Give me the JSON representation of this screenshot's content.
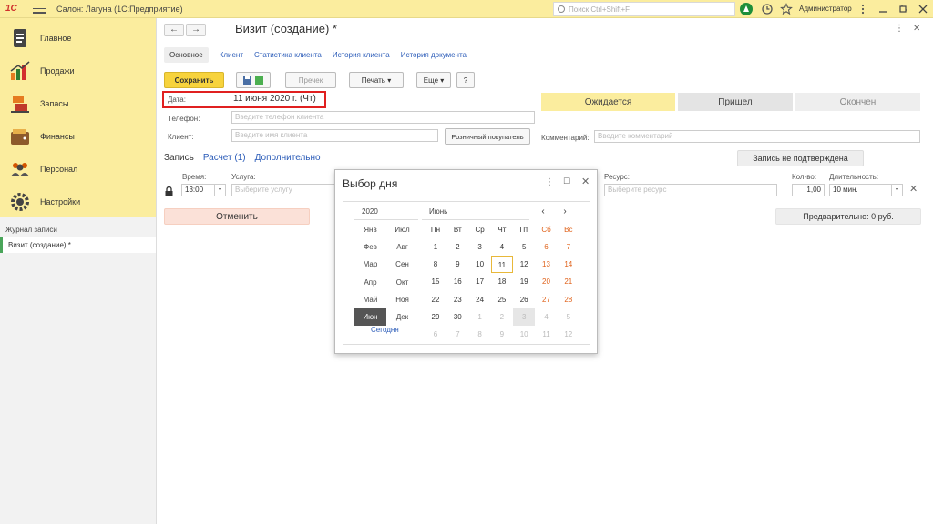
{
  "app": {
    "title": "Салон: Лагуна  (1С:Предприятие)",
    "logo": "1С",
    "search_placeholder": "Поиск Ctrl+Shift+F",
    "user": "Администратор"
  },
  "sidebar": {
    "sections": [
      {
        "label": "Главное",
        "icon": "main-doc-icon"
      },
      {
        "label": "Продажи",
        "icon": "sales-chart-icon"
      },
      {
        "label": "Запасы",
        "icon": "stock-icon"
      },
      {
        "label": "Финансы",
        "icon": "wallet-icon"
      },
      {
        "label": "Персонал",
        "icon": "people-icon"
      },
      {
        "label": "Настройки",
        "icon": "gear-icon"
      }
    ],
    "journal": "Журнал записи",
    "open_item": "Визит (создание) *"
  },
  "form": {
    "title": "Визит (создание) *",
    "tabs": [
      "Основное",
      "Клиент",
      "Статистика клиента",
      "История клиента",
      "История документа"
    ],
    "toolbar": {
      "save": "Сохранить",
      "prechek": "Пречек",
      "print": "Печать",
      "more": "Еще",
      "help": "?"
    },
    "date_label": "Дата:",
    "date_value": "11 июня 2020 г. (Чт)",
    "phone_label": "Телефон:",
    "phone_placeholder": "Введите телефон клиента",
    "client_label": "Клиент:",
    "client_placeholder": "Введите имя клиента",
    "retail_button": "Розничный покупатель",
    "statuses": [
      "Ожидается",
      "Пришел",
      "Окончен"
    ],
    "comment_label": "Комментарий:",
    "comment_placeholder": "Введите комментарий",
    "subtabs": [
      "Запись",
      "Расчет (1)",
      "Дополнительно"
    ],
    "not_confirmed": "Запись не подтверждена",
    "time_label": "Время:",
    "time_value": "13:00",
    "service_label": "Услуга:",
    "service_placeholder": "Выберите услугу",
    "resource_label": "Ресурс:",
    "resource_placeholder": "Выберите ресурс",
    "qty_label": "Кол-во:",
    "qty_value": "1,00",
    "duration_label": "Длительность:",
    "duration_value": "10 мин.",
    "cancel_button": "Отменить",
    "prelim": "Предварительно: 0 руб."
  },
  "picker": {
    "title": "Выбор дня",
    "year": "2020",
    "month": "Июнь",
    "months": [
      "Янв",
      "Июл",
      "Фев",
      "Авг",
      "Мар",
      "Сен",
      "Апр",
      "Окт",
      "Май",
      "Ноя",
      "Июн",
      "Дек"
    ],
    "selected_month": "Июн",
    "today": "Сегодня",
    "weekdays": [
      "Пн",
      "Вт",
      "Ср",
      "Чт",
      "Пт",
      "Сб",
      "Вс"
    ],
    "days": [
      [
        "1",
        "2",
        "3",
        "4",
        "5",
        "6",
        "7"
      ],
      [
        "8",
        "9",
        "10",
        "11",
        "12",
        "13",
        "14"
      ],
      [
        "15",
        "16",
        "17",
        "18",
        "19",
        "20",
        "21"
      ],
      [
        "22",
        "23",
        "24",
        "25",
        "26",
        "27",
        "28"
      ],
      [
        "29",
        "30",
        "1",
        "2",
        "3",
        "4",
        "5"
      ],
      [
        "6",
        "7",
        "8",
        "9",
        "10",
        "11",
        "12"
      ]
    ],
    "selected_day": "11",
    "colors": {
      "weekend": "#e0621a",
      "selected_border": "#e8b83a",
      "accent_yellow": "#f7d33d",
      "expected_status": "#fbed9e"
    }
  }
}
